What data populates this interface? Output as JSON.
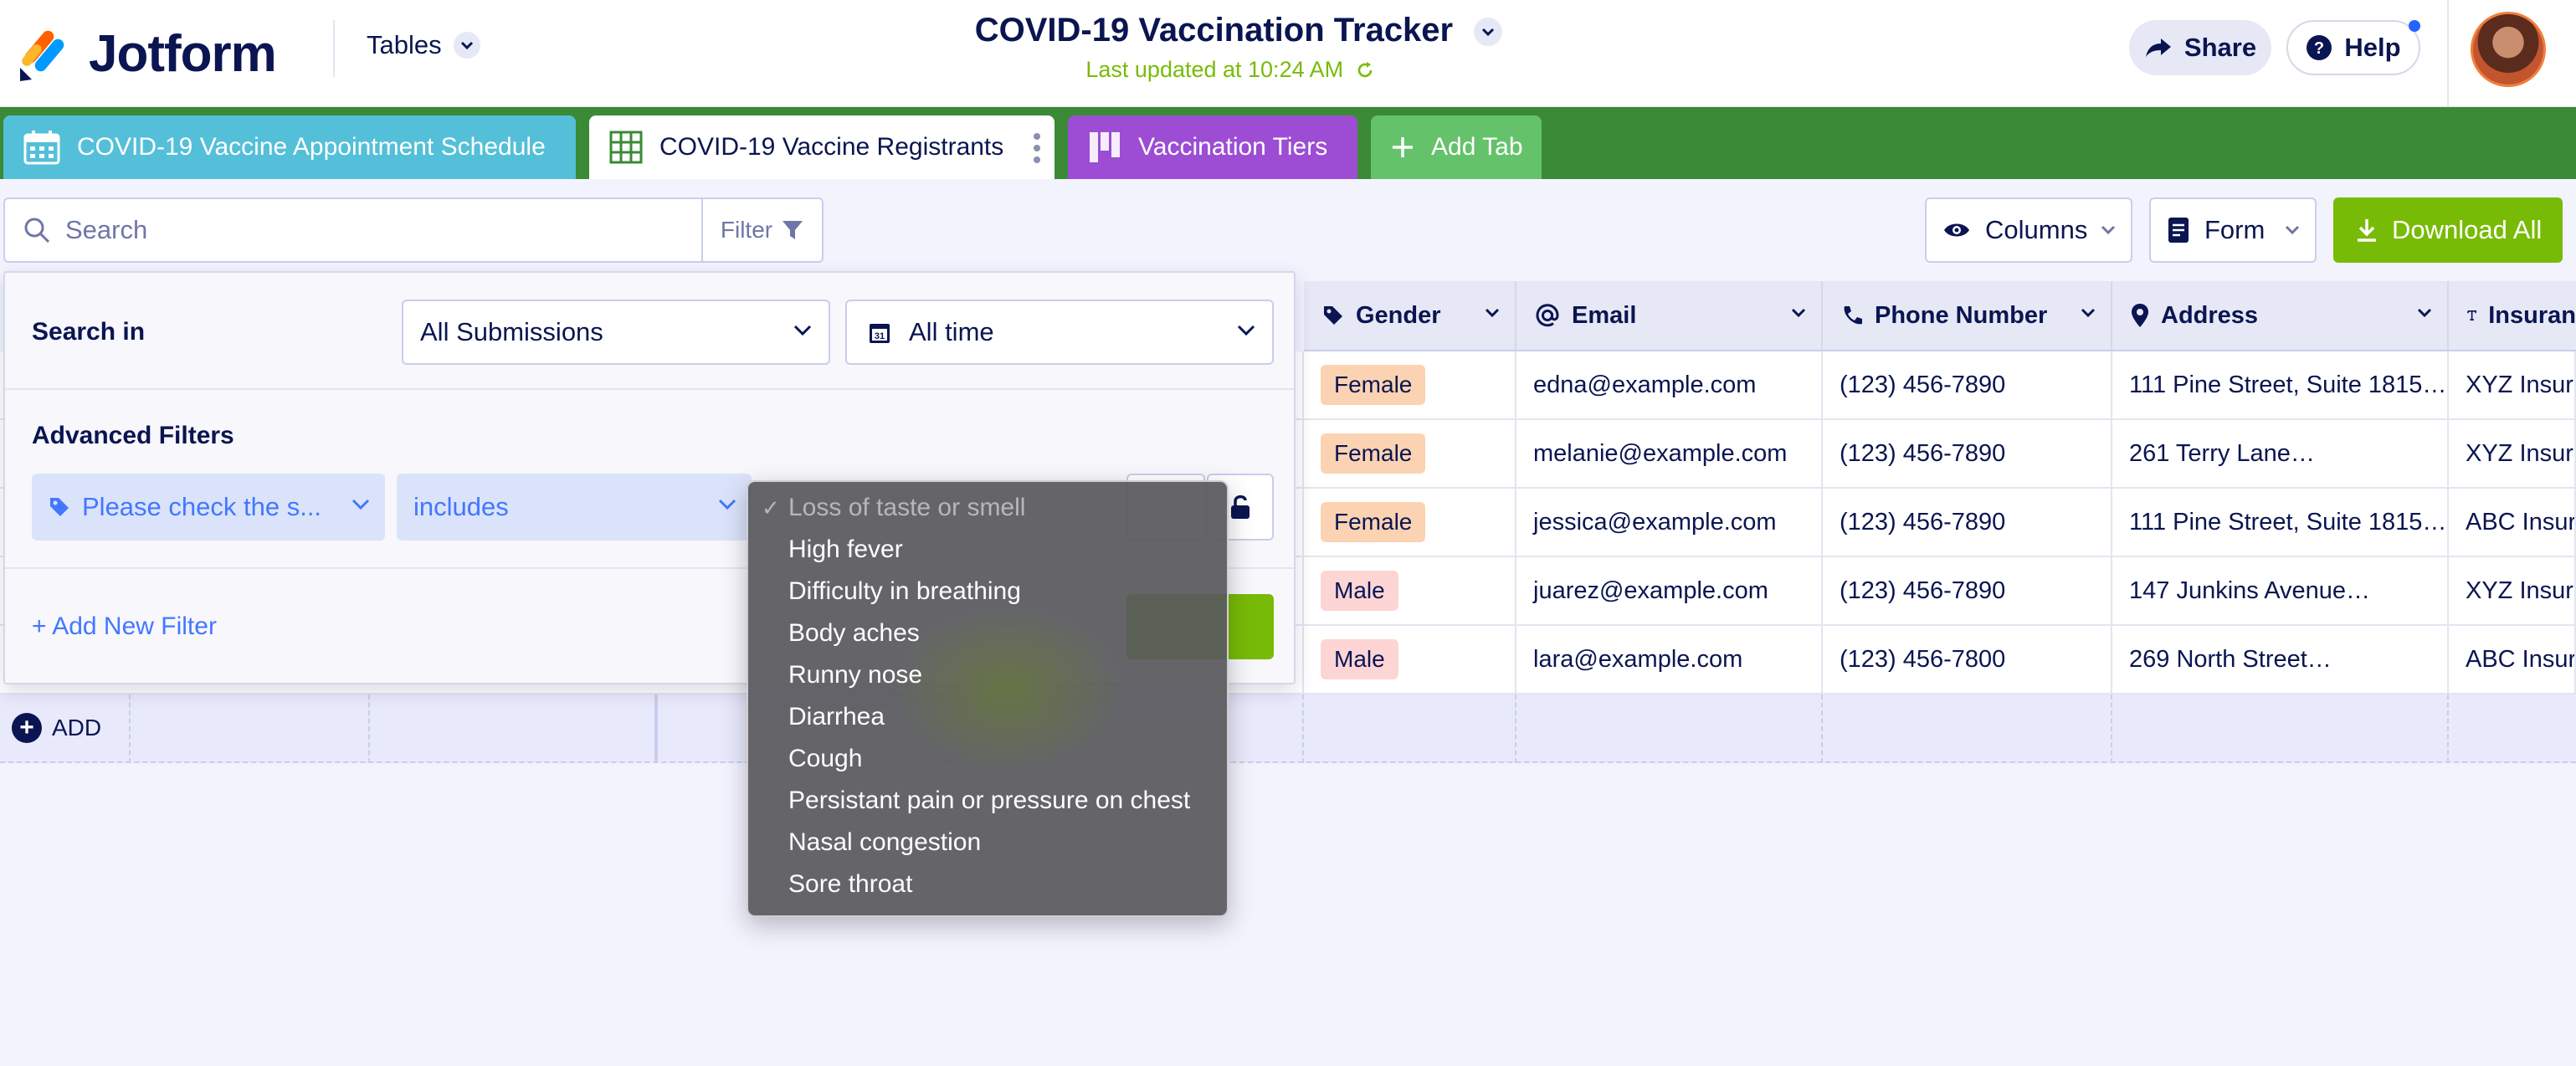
{
  "app": {
    "brand": "Jotform",
    "menu_label": "Tables"
  },
  "document": {
    "title": "COVID-19 Vaccination Tracker",
    "last_updated": "Last updated at 10:24 AM"
  },
  "header": {
    "share_label": "Share",
    "help_label": "Help"
  },
  "tabs": [
    {
      "label": "COVID-19 Vaccine Appointment Schedule",
      "color": "#54bfd8"
    },
    {
      "label": "COVID-19 Vaccine Registrants",
      "color": "#ffffff",
      "active": true
    },
    {
      "label": "Vaccination Tiers",
      "color": "#9c4dd3"
    },
    {
      "label": "Add Tab",
      "color": "#64c26b"
    }
  ],
  "toolbar": {
    "search_placeholder": "Search",
    "filter_label": "Filter",
    "columns_label": "Columns",
    "form_label": "Form",
    "download_label": "Download All"
  },
  "columns": [
    "Gender",
    "Email",
    "Phone Number",
    "Address",
    "Insuran"
  ],
  "rows": [
    {
      "gender": "Female",
      "email": "edna@example.com",
      "phone": "(123) 456-7890",
      "address": "111 Pine Street, Suite 1815…",
      "insurance": "XYZ Insura"
    },
    {
      "gender": "Female",
      "email": "melanie@example.com",
      "phone": "(123) 456-7890",
      "address": "261 Terry Lane…",
      "insurance": "XYZ Insura"
    },
    {
      "gender": "Female",
      "email": "jessica@example.com",
      "phone": "(123) 456-7890",
      "address": "111 Pine Street, Suite 1815…",
      "insurance": "ABC Insura"
    },
    {
      "gender": "Male",
      "email": "juarez@example.com",
      "phone": "(123) 456-7890",
      "address": "147 Junkins Avenue…",
      "insurance": "XYZ Insura"
    },
    {
      "gender": "Male",
      "email": "lara@example.com",
      "phone": "(123) 456-7800",
      "address": "269 North Street…",
      "insurance": "ABC Insura"
    }
  ],
  "add_row_label": "ADD",
  "filter_panel": {
    "search_in_label": "Search in",
    "submissions_value": "All Submissions",
    "time_value": "All time",
    "advanced_title": "Advanced Filters",
    "field_value": "Please check the s...",
    "operator_value": "includes",
    "add_filter_label": "+ Add New Filter"
  },
  "dropdown": {
    "selected": "Loss of taste or smell",
    "options": [
      "Loss of taste or smell",
      "High fever",
      "Difficulty in breathing",
      "Body aches",
      "Runny nose",
      "Diarrhea",
      "Cough",
      "Persistant pain or pressure on chest",
      "Nasal congestion",
      "Sore throat"
    ]
  },
  "colors": {
    "accent_green": "#78bb07",
    "tabs_bar": "#3b8a35",
    "navy": "#0a1551",
    "link_blue": "#4277ff"
  }
}
